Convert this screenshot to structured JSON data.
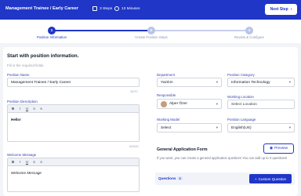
{
  "header": {
    "title": "Management Trainee / Early Career",
    "steps_meta": "3 Steps",
    "duration_meta": "13 Minutes",
    "next_button": "Next Step"
  },
  "stepper": {
    "steps": [
      {
        "number": "1",
        "label": "Position Information",
        "state": "active"
      },
      {
        "number": "2",
        "label": "Create Position Steps",
        "state": "idle"
      },
      {
        "number": "3",
        "label": "Review & Configure",
        "state": "idle"
      }
    ]
  },
  "form": {
    "title": "Start with position information.",
    "subtitle": "Fill in the required fields.",
    "position_name": {
      "label": "Position Name",
      "value": "Management Trainee / Early Career",
      "counter": "33/70"
    },
    "position_description": {
      "label": "Position Description",
      "content": "Hello!",
      "counter": "6/2000"
    },
    "welcome_message": {
      "label": "Welcome Message",
      "content": "Welcome Message"
    },
    "toolbar": [
      "B",
      "I",
      "U",
      "≡",
      "≡"
    ],
    "department": {
      "label": "Department",
      "value": "Yazılım"
    },
    "position_category": {
      "label": "Position Category",
      "value": "Information Technology"
    },
    "responsible": {
      "label": "Responsible",
      "value": "Alper Özer"
    },
    "working_location": {
      "label": "Working Location",
      "placeholder": "Select Location"
    },
    "working_model": {
      "label": "Working Model",
      "value": "Select"
    },
    "position_language": {
      "label": "Position Language",
      "value": "English(US)"
    }
  },
  "application_form": {
    "title": "General Application Form",
    "preview_button": "Preview",
    "description": "If you want, you can create a general application question! You can add up to 3 questions!",
    "questions_label": "Questions",
    "questions_count": "0",
    "custom_question_button": "Custom Question"
  },
  "colors": {
    "primary": "#1f36c7",
    "label": "#2f3fae",
    "stepper_idle": "#b9c4ea"
  }
}
